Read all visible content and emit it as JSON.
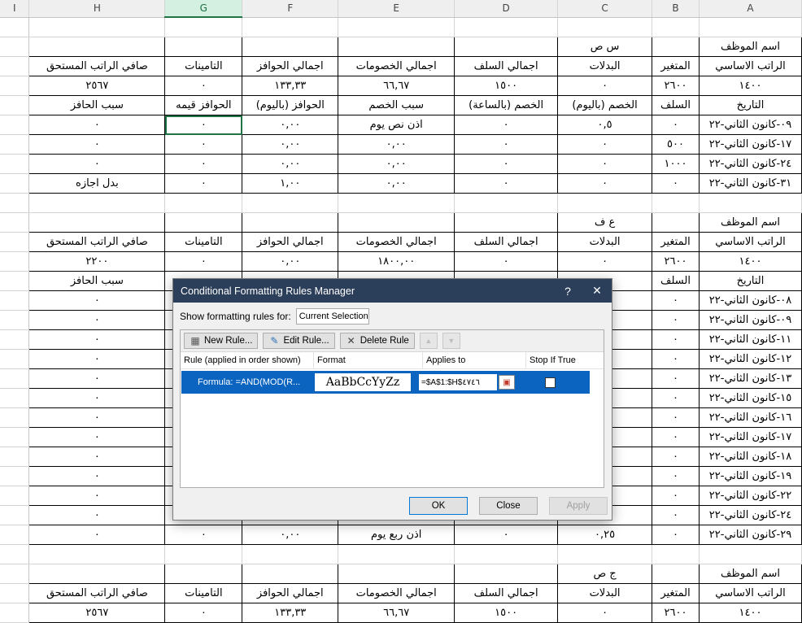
{
  "columns": [
    "I",
    "H",
    "G",
    "F",
    "E",
    "D",
    "C",
    "B",
    "A"
  ],
  "selected_column": "G",
  "col_widths": [
    36,
    167,
    95,
    118,
    143,
    127,
    116,
    58,
    126
  ],
  "rows": [
    {
      "cells": [
        "",
        "",
        "",
        "",
        "",
        "",
        "",
        "",
        ""
      ]
    },
    {
      "cells": [
        "",
        "",
        "",
        "",
        "",
        "",
        "س ص",
        "",
        "اسم الموظف"
      ]
    },
    {
      "cells": [
        "",
        "صافي الراتب المستحق",
        "التامينات",
        "اجمالي الحوافز",
        "اجمالي الخصومات",
        "اجمالي السلف",
        "البدلات",
        "المتغير",
        "الراتب الاساسي"
      ]
    },
    {
      "cells": [
        "",
        "٢٥٦٧",
        "٠",
        "١٣٣,٣٣",
        "٦٦,٦٧",
        "١٥٠٠",
        "٠",
        "٢٦٠٠",
        "١٤٠٠"
      ]
    },
    {
      "cells": [
        "",
        "سبب الحافز",
        "الحوافز قيمه",
        "الحوافز (باليوم)",
        "سبب الخصم",
        "الخصم (بالساعة)",
        "الخصم (باليوم)",
        "السلف",
        "التاريخ"
      ]
    },
    {
      "cells": [
        "",
        "٠",
        "٠",
        "٠,٠٠",
        "اذن نص يوم",
        "٠",
        "٠,٥",
        "٠",
        "٠٩-كانون الثاني-٢٢"
      ]
    },
    {
      "cells": [
        "",
        "٠",
        "٠",
        "٠,٠٠",
        "٠,٠٠",
        "٠",
        "٠",
        "٥٠٠",
        "١٧-كانون الثاني-٢٢"
      ]
    },
    {
      "cells": [
        "",
        "٠",
        "٠",
        "٠,٠٠",
        "٠,٠٠",
        "٠",
        "٠",
        "١٠٠٠",
        "٢٤-كانون الثاني-٢٢"
      ]
    },
    {
      "cells": [
        "",
        "بدل اجازه",
        "٠",
        "١,٠٠",
        "٠,٠٠",
        "٠",
        "٠",
        "٠",
        "٣١-كانون الثاني-٢٢"
      ]
    },
    {
      "cells": [
        "",
        "",
        "",
        "",
        "",
        "",
        "",
        "",
        ""
      ]
    },
    {
      "cells": [
        "",
        "",
        "",
        "",
        "",
        "",
        "ع ف",
        "",
        "اسم الموظف"
      ]
    },
    {
      "cells": [
        "",
        "صافي الراتب المستحق",
        "التامينات",
        "اجمالي الحوافز",
        "اجمالي الخصومات",
        "اجمالي السلف",
        "البدلات",
        "المتغير",
        "الراتب الاساسي"
      ]
    },
    {
      "cells": [
        "",
        "٢٢٠٠",
        "٠",
        "٠,٠٠",
        "١٨٠٠,٠٠",
        "٠",
        "٠",
        "٢٦٠٠",
        "١٤٠٠"
      ]
    },
    {
      "cells": [
        "",
        "سبب الحافز",
        "",
        "",
        "",
        "",
        "",
        "السلف",
        "التاريخ"
      ]
    },
    {
      "cells": [
        "",
        "٠",
        "",
        "",
        "",
        "",
        "",
        "٠",
        "٠٨-كانون الثاني-٢٢"
      ]
    },
    {
      "cells": [
        "",
        "٠",
        "",
        "",
        "",
        "",
        "",
        "٠",
        "٠٩-كانون الثاني-٢٢"
      ]
    },
    {
      "cells": [
        "",
        "٠",
        "",
        "",
        "",
        "",
        "",
        "٠",
        "١١-كانون الثاني-٢٢"
      ]
    },
    {
      "cells": [
        "",
        "٠",
        "",
        "",
        "",
        "",
        "",
        "٠",
        "١٢-كانون الثاني-٢٢"
      ]
    },
    {
      "cells": [
        "",
        "٠",
        "",
        "",
        "",
        "",
        "",
        "٠",
        "١٣-كانون الثاني-٢٢"
      ]
    },
    {
      "cells": [
        "",
        "٠",
        "",
        "",
        "",
        "",
        "",
        "٠",
        "١٥-كانون الثاني-٢٢"
      ]
    },
    {
      "cells": [
        "",
        "٠",
        "",
        "",
        "",
        "",
        "",
        "٠",
        "١٦-كانون الثاني-٢٢"
      ]
    },
    {
      "cells": [
        "",
        "٠",
        "",
        "",
        "",
        "",
        "",
        "٠",
        "١٧-كانون الثاني-٢٢"
      ]
    },
    {
      "cells": [
        "",
        "٠",
        "",
        "",
        "",
        "",
        "",
        "٠",
        "١٨-كانون الثاني-٢٢"
      ]
    },
    {
      "cells": [
        "",
        "٠",
        "",
        "",
        "",
        "",
        "",
        "٠",
        "١٩-كانون الثاني-٢٢"
      ]
    },
    {
      "cells": [
        "",
        "٠",
        "",
        "",
        "",
        "",
        "",
        "٠",
        "٢٢-كانون الثاني-٢٢"
      ]
    },
    {
      "cells": [
        "",
        "٠",
        "",
        "",
        "",
        "",
        "",
        "٠",
        "٢٤-كانون الثاني-٢٢"
      ]
    },
    {
      "cells": [
        "",
        "٠",
        "٠",
        "٠,٠٠",
        "اذن ربع يوم",
        "٠",
        "٠,٢٥",
        "٠",
        "٢٩-كانون الثاني-٢٢"
      ]
    },
    {
      "cells": [
        "",
        "",
        "",
        "",
        "",
        "",
        "",
        "",
        ""
      ]
    },
    {
      "cells": [
        "",
        "",
        "",
        "",
        "",
        "",
        "ج ص",
        "",
        "اسم الموظف"
      ]
    },
    {
      "cells": [
        "",
        "صافي الراتب المستحق",
        "التامينات",
        "اجمالي الحوافز",
        "اجمالي الخصومات",
        "اجمالي السلف",
        "البدلات",
        "المتغير",
        "الراتب الاساسي"
      ]
    },
    {
      "cells": [
        "",
        "٢٥٦٧",
        "٠",
        "١٣٣,٣٣",
        "٦٦,٦٧",
        "١٥٠٠",
        "٠",
        "٢٦٠٠",
        "١٤٠٠"
      ]
    }
  ],
  "dialog": {
    "title": "Conditional Formatting Rules Manager",
    "help": "?",
    "close": "✕",
    "show_rules_label": "Show formatting rules for:",
    "show_rules_value": "Current Selection",
    "new_rule": "New Rule...",
    "edit_rule": "Edit Rule...",
    "delete_rule": "Delete Rule",
    "col_rule": "Rule (applied in order shown)",
    "col_format": "Format",
    "col_applies": "Applies to",
    "col_stop": "Stop If True",
    "rule_formula": "Formula: =AND(MOD(R...",
    "rule_preview": "AaBbCcYyZz",
    "rule_applies": "=$A$1:$H$٤٧٤٦",
    "ok": "OK",
    "close_btn": "Close",
    "apply": "Apply"
  }
}
